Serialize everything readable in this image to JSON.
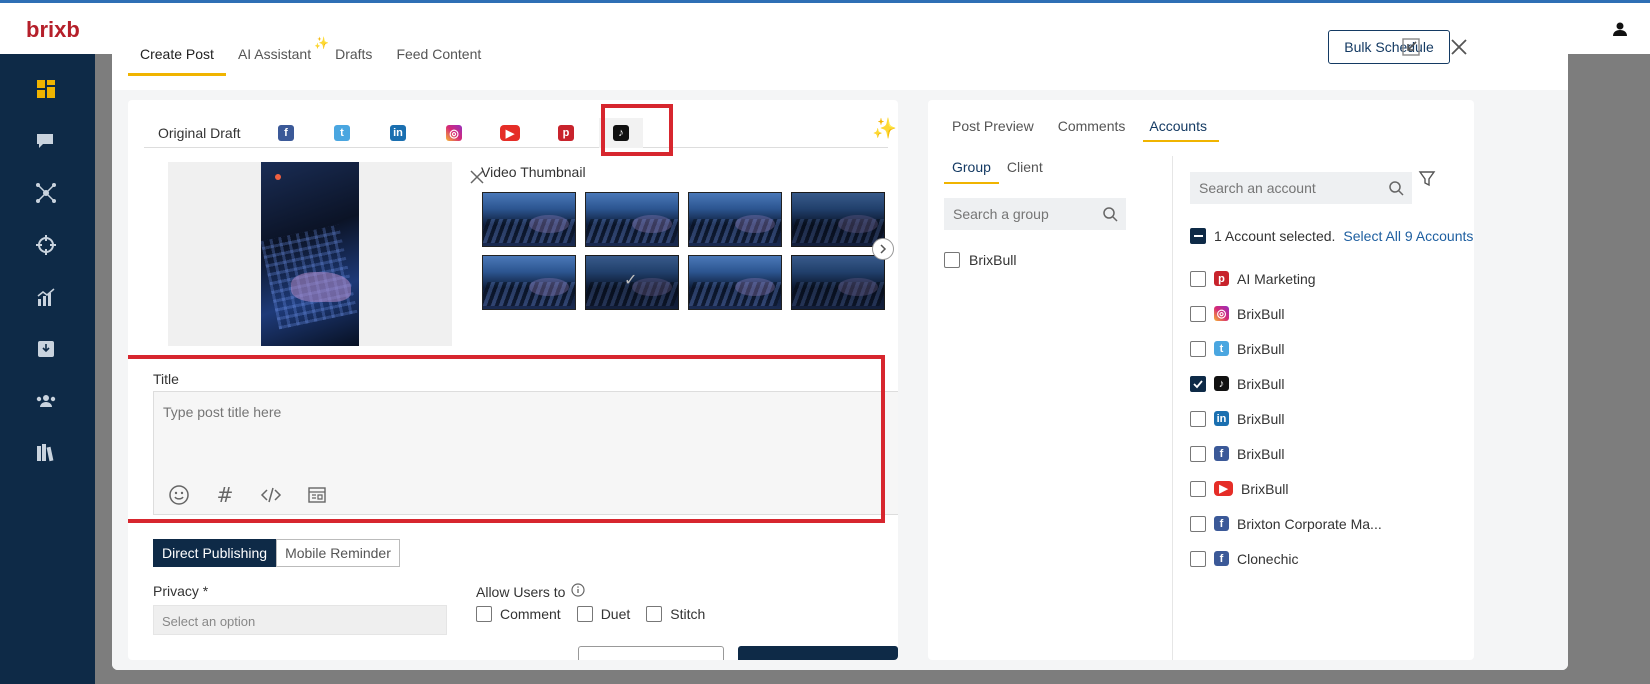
{
  "app": {
    "brand": "brixb"
  },
  "modal": {
    "tabs": [
      {
        "label": "Create Post"
      },
      {
        "label": "AI Assistant"
      },
      {
        "label": "Drafts"
      },
      {
        "label": "Feed Content"
      }
    ],
    "bulk_schedule": "Bulk Schedule"
  },
  "editor": {
    "original_draft": "Original Draft",
    "networks": [
      "facebook-icon",
      "twitter-icon",
      "linkedin-icon",
      "instagram-icon",
      "youtube-icon",
      "pinterest-icon",
      "tiktok-icon"
    ],
    "active_network": "tiktok",
    "video_thumbnail_label": "Video Thumbnail",
    "selected_thumbnail": 6,
    "title_label": "Title",
    "title_placeholder": "Type post title here",
    "publish_modes": {
      "direct": "Direct Publishing",
      "mobile": "Mobile Reminder"
    },
    "privacy_label": "Privacy *",
    "privacy_placeholder": "Select an option",
    "allow_label": "Allow Users to",
    "allow_options": {
      "comment": "Comment",
      "duet": "Duet",
      "stitch": "Stitch"
    }
  },
  "right": {
    "tabs": {
      "preview": "Post Preview",
      "comments": "Comments",
      "accounts": "Accounts"
    },
    "group_tabs": {
      "group": "Group",
      "client": "Client"
    },
    "group_search_placeholder": "Search a group",
    "groups": [
      "BrixBull"
    ],
    "account_search_placeholder": "Search an account",
    "selected_text": "1 Account selected.",
    "select_all": "Select All 9 Accounts",
    "accounts": [
      {
        "name": "AI Marketing",
        "network": "pinterest",
        "checked": false
      },
      {
        "name": "BrixBull",
        "network": "instagram",
        "checked": false
      },
      {
        "name": "BrixBull",
        "network": "twitter",
        "checked": false
      },
      {
        "name": "BrixBull",
        "network": "tiktok",
        "checked": true
      },
      {
        "name": "BrixBull",
        "network": "linkedin",
        "checked": false
      },
      {
        "name": "BrixBull",
        "network": "facebook",
        "checked": false
      },
      {
        "name": "BrixBull",
        "network": "youtube",
        "checked": false
      },
      {
        "name": "Brixton Corporate Ma...",
        "network": "facebook",
        "checked": false
      },
      {
        "name": "Clonechic",
        "network": "facebook",
        "checked": false
      }
    ]
  },
  "colors": {
    "navy": "#0e2a47",
    "accent": "#f0b400",
    "highlight": "#d7262e",
    "link": "#1e5fa0"
  }
}
